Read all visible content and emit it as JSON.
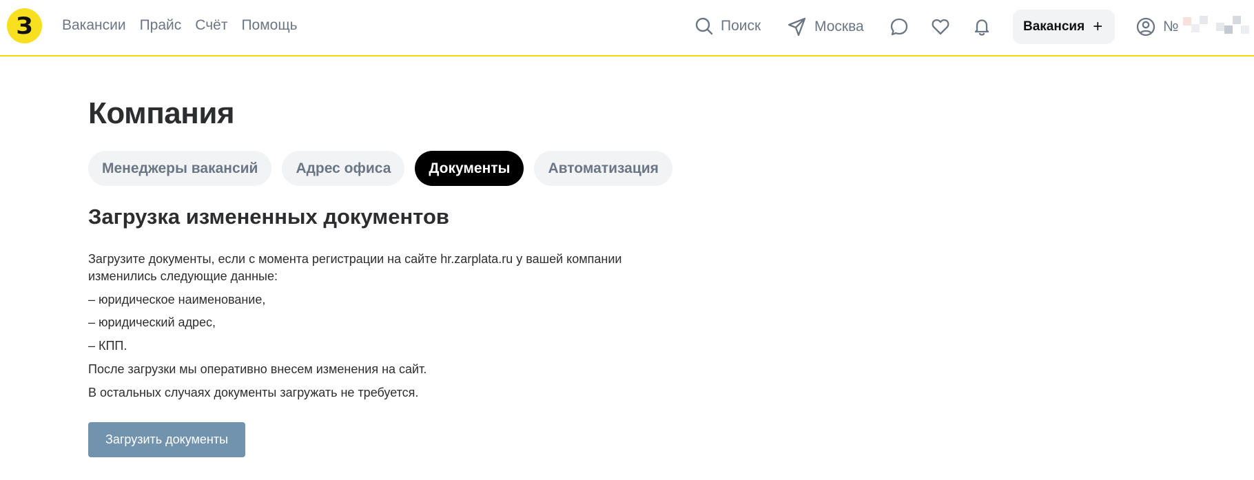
{
  "header": {
    "logo_text": "З",
    "nav": [
      "Вакансии",
      "Прайс",
      "Счёт",
      "Помощь"
    ],
    "search_label": "Поиск",
    "city_label": "Москва",
    "vacancy_button": "Вакансия",
    "vacancy_plus": "+",
    "account_number_prefix": "№",
    "accent_color": "#f5d90a"
  },
  "page": {
    "title": "Компания",
    "tabs": [
      {
        "label": "Менеджеры вакансий",
        "active": false
      },
      {
        "label": "Адрес офиса",
        "active": false
      },
      {
        "label": "Документы",
        "active": true
      },
      {
        "label": "Автоматизация",
        "active": false
      }
    ],
    "section_title": "Загрузка измененных документов",
    "paragraphs": [
      "Загрузите документы, если с момента регистрации на сайте hr.zarplata.ru у вашей компании изменились следующие данные:",
      "– юридическое наименование,",
      "– юридический адрес,",
      "– КПП.",
      "После загрузки мы оперативно внесем изменения на сайт.",
      "В остальных случаях документы загружать не требуется."
    ],
    "upload_button": "Загрузить документы",
    "upload_button_color": "#7193ad"
  }
}
